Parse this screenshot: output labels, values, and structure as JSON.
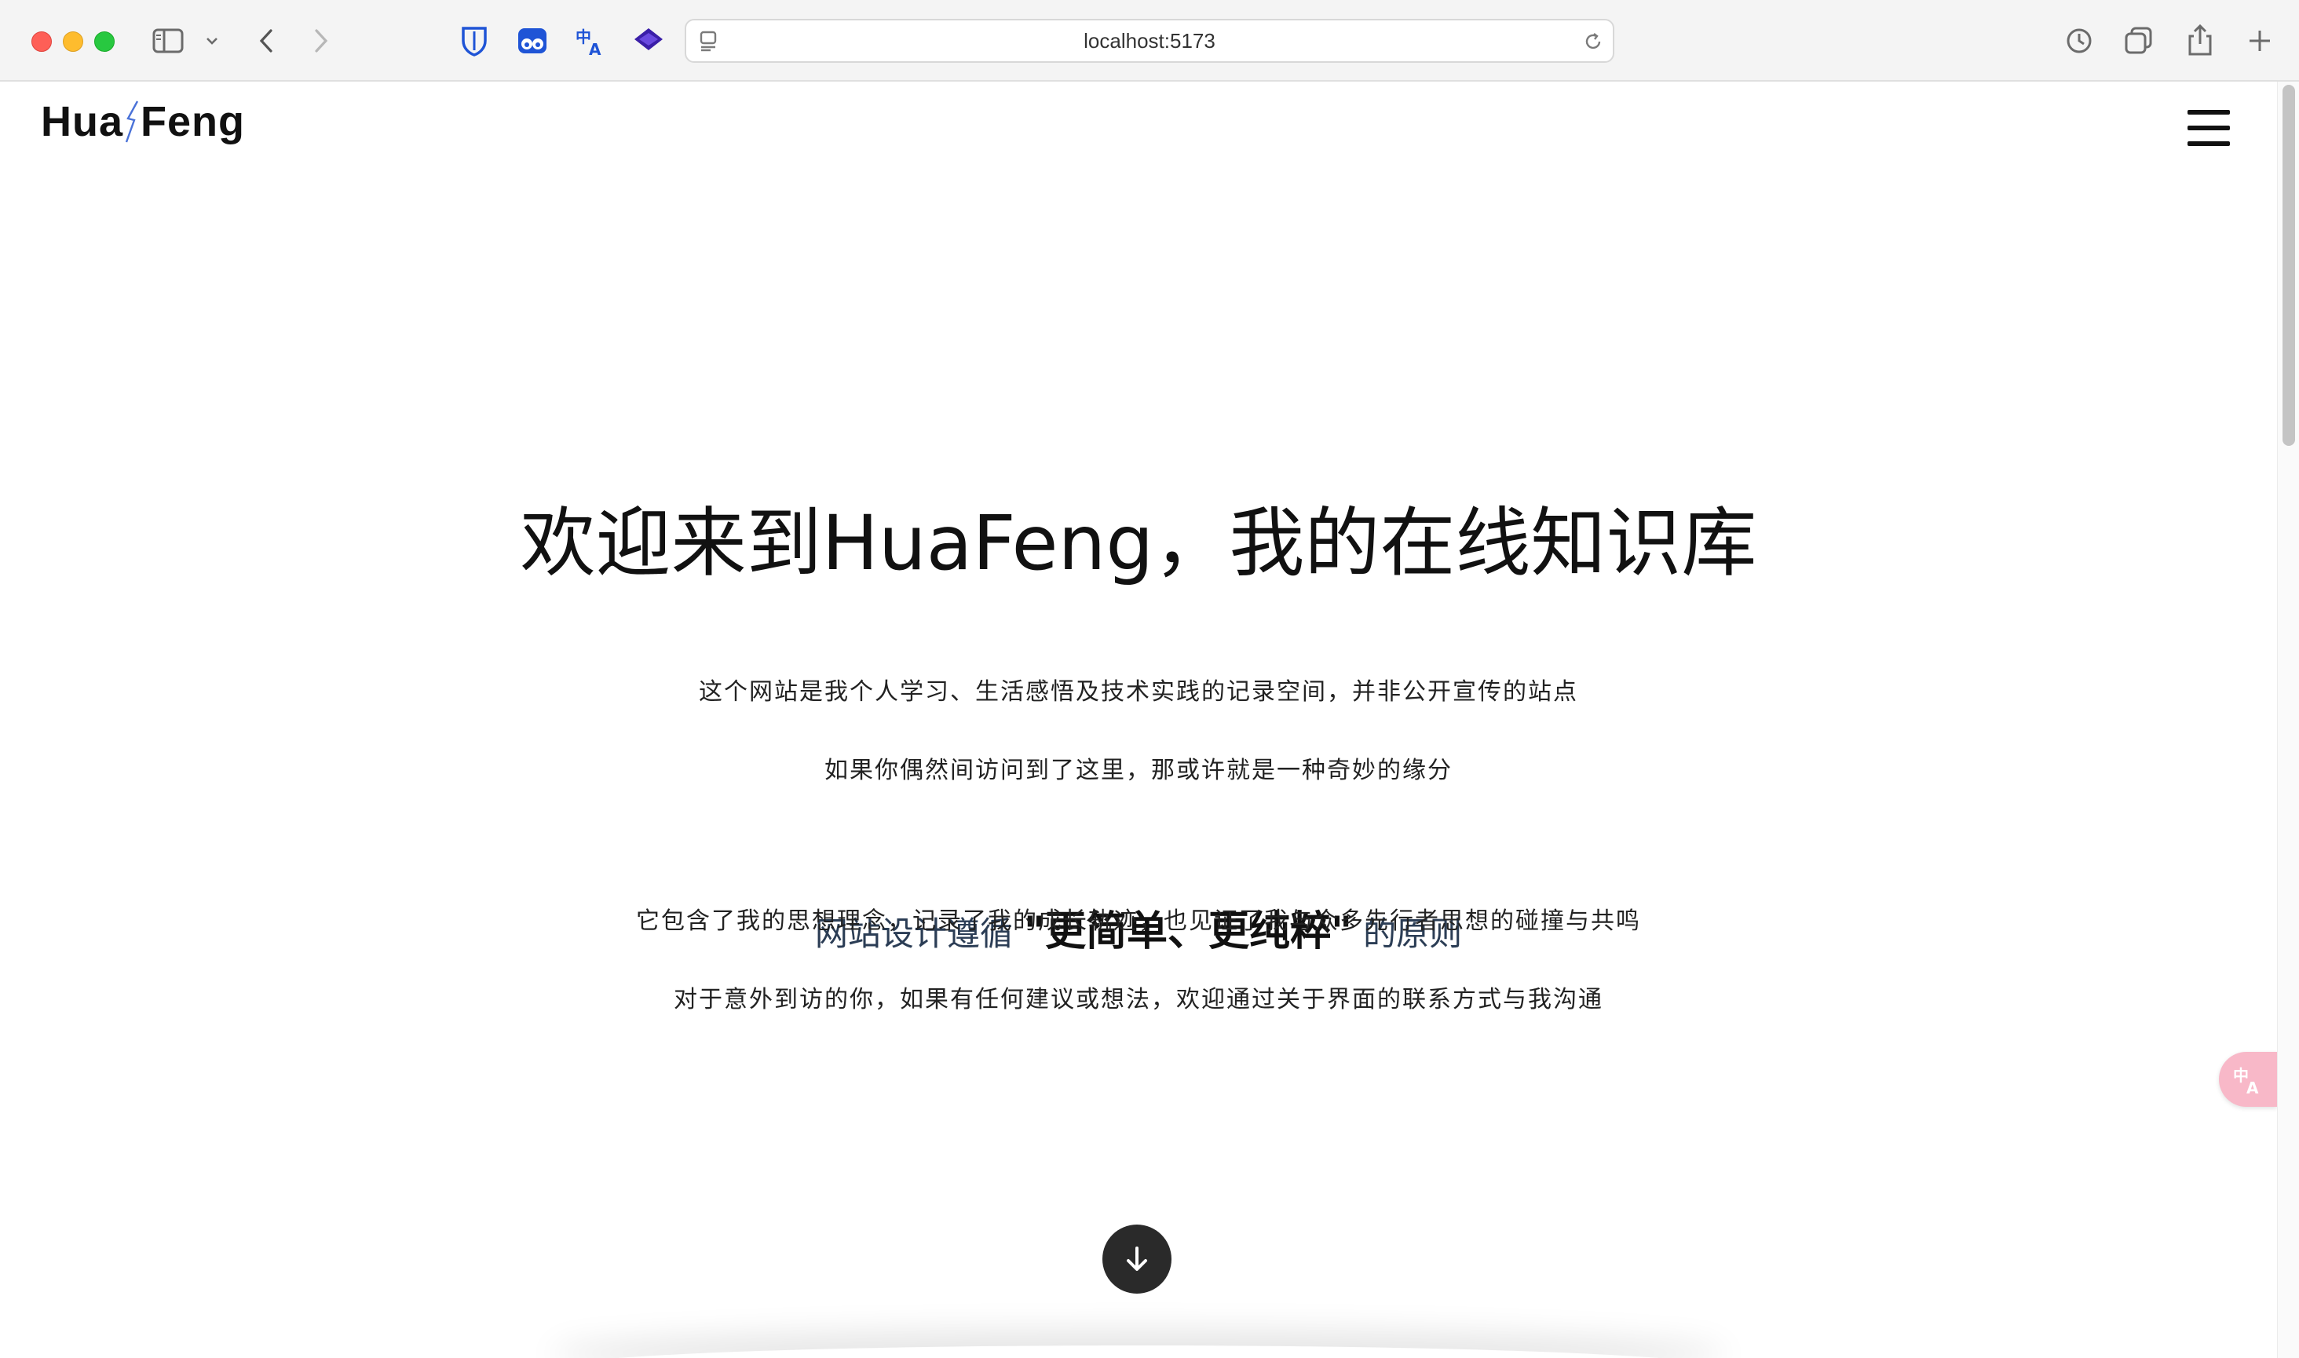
{
  "browser": {
    "url": "localhost:5173"
  },
  "site": {
    "logo_left": "Hua",
    "logo_right": "Feng"
  },
  "hero": {
    "title": "欢迎来到HuaFeng，我的在线知识库",
    "line1": "这个网站是我个人学习、生活感悟及技术实践的记录空间，并非公开宣传的站点",
    "line2": "如果你偶然间访问到了这里，那或许就是一种奇妙的缘分",
    "principle_prefix": "网站设计遵循",
    "principle_strong": "\"更简单、更纯粹\"",
    "principle_suffix": "的原则",
    "line3": "它包含了我的思想理念，记录了我的成长轨迹，也见证了我与众多先行者思想的碰撞与共鸣",
    "line4": "对于意外到访的你，如果有任何建议或想法，欢迎通过关于界面的联系方式与我沟通"
  },
  "colors": {
    "accent_icon_blue": "#1f54d6",
    "translate_float": "#f8b8c8",
    "scroll_button": "#2a2a2a"
  }
}
